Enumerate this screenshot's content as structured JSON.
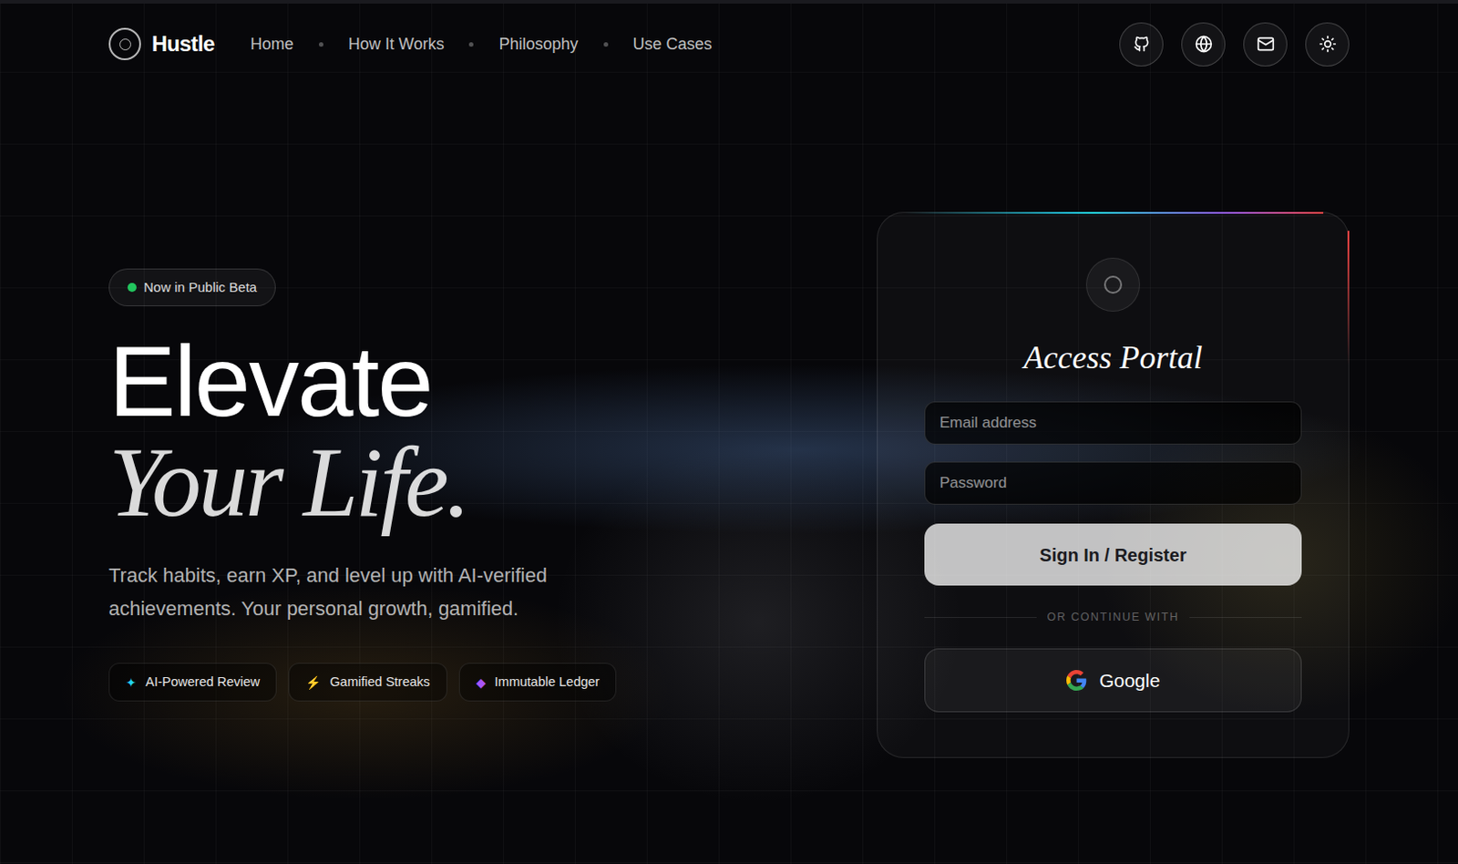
{
  "brand": "Hustle",
  "nav": [
    {
      "label": "Home"
    },
    {
      "label": "How It Works"
    },
    {
      "label": "Philosophy"
    },
    {
      "label": "Use Cases"
    }
  ],
  "icon_buttons": [
    {
      "kind": "github"
    },
    {
      "kind": "globe"
    },
    {
      "kind": "mail"
    },
    {
      "kind": "theme"
    }
  ],
  "badge": {
    "label": "Now in Public Beta"
  },
  "headline": {
    "line1": "Elevate",
    "line2": "Your Life."
  },
  "subtitle": "Track habits, earn XP, and level up with AI-verified achievements. Your personal growth, gamified.",
  "features": [
    {
      "label": "AI-Powered Review",
      "icon": "✦",
      "color": "#22d3ee"
    },
    {
      "label": "Gamified Streaks",
      "icon": "⚡",
      "color": "#facc15"
    },
    {
      "label": "Immutable Ledger",
      "icon": "◆",
      "color": "#a855f7"
    }
  ],
  "portal": {
    "title": "Access Portal",
    "email_placeholder": "Email address",
    "password_placeholder": "Password",
    "submit": "Sign In / Register",
    "divider": "OR CONTINUE WITH",
    "google": "Google"
  }
}
